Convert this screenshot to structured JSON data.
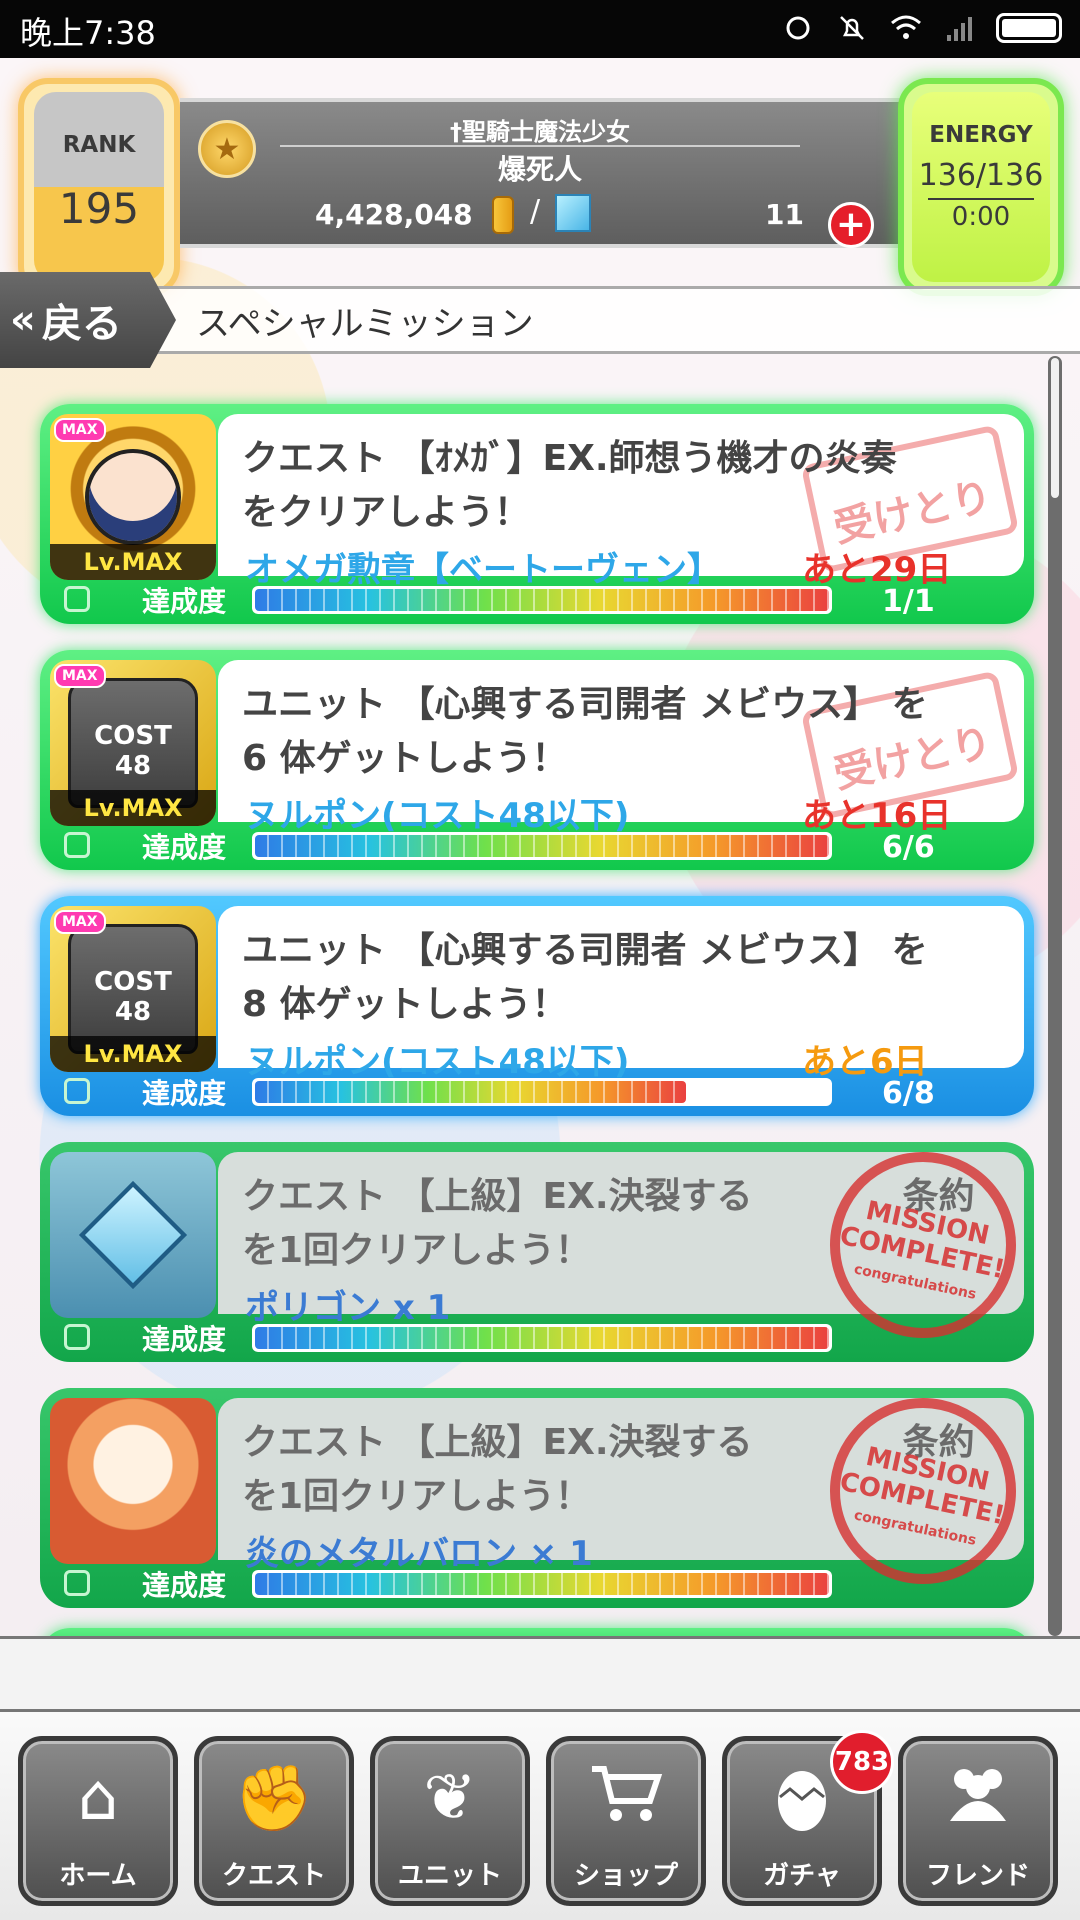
{
  "status_bar": {
    "time": "晚上7:38"
  },
  "header": {
    "rank_label": "RANK",
    "rank_value": "195",
    "title": "†聖騎士魔法少女",
    "player_name": "爆死人",
    "coins": "4,428,048",
    "slash": "/",
    "gems": "11",
    "energy_label": "ENERGY",
    "energy_value": "136/136",
    "energy_timer": "0:00"
  },
  "nav": {
    "back_label": "戻る",
    "page_title": "スペシャルミッション"
  },
  "missions": [
    {
      "line1": "クエスト 【ｵﾒｶﾞ】EX.師想う機才の炎奏",
      "line2": "をクリアしよう！",
      "reward": "オメガ勲章【ベートーヴェン】",
      "days": "あと29日",
      "progress_label": "達成度",
      "count": "1/1",
      "progress": 1.0,
      "stamp": "受けとり",
      "thumb_max": "MAX",
      "thumb_lv": "Lv.MAX"
    },
    {
      "line1": "ユニット 【心興する司開者 メビウス】 を",
      "line2": "6 体ゲットしよう！",
      "reward": "ヌルポン(コスト48以下)",
      "days": "あと16日",
      "progress_label": "達成度",
      "count": "6/6",
      "progress": 1.0,
      "stamp": "受けとり",
      "thumb_max": "MAX",
      "thumb_cost": "COST",
      "thumb_cost_value": "48",
      "thumb_lv": "Lv.MAX"
    },
    {
      "line1": "ユニット 【心興する司開者 メビウス】 を",
      "line2": "8 体ゲットしよう！",
      "reward": "ヌルポン(コスト48以下)",
      "days": "あと6日",
      "progress_label": "達成度",
      "count": "6/8",
      "progress": 0.75,
      "thumb_max": "MAX",
      "thumb_cost": "COST",
      "thumb_cost_value": "48",
      "thumb_lv": "Lv.MAX"
    },
    {
      "line1": "クエスト 【上級】EX.決裂する",
      "line1b": "条約",
      "line2": "を1回クリアしよう！",
      "reward": "ポリゴン x 1",
      "progress_label": "達成度",
      "progress": 1.0,
      "stamp_line1": "MISSION",
      "stamp_line2": "COMPLETE!",
      "stamp_line3": "congratulations"
    },
    {
      "line1": "クエスト 【上級】EX.決裂する",
      "line1b": "条約",
      "line2": "を1回クリアしよう！",
      "reward": "炎のメタルバロン × 1",
      "progress_label": "達成度",
      "progress": 1.0,
      "stamp_line1": "MISSION",
      "stamp_line2": "COMPLETE!",
      "stamp_line3": "congratulations"
    }
  ],
  "tabs": {
    "home": "ホーム",
    "quest": "クエスト",
    "unit": "ユニット",
    "shop": "ショップ",
    "gacha": "ガチャ",
    "friend": "フレンド",
    "gacha_badge": "783"
  }
}
